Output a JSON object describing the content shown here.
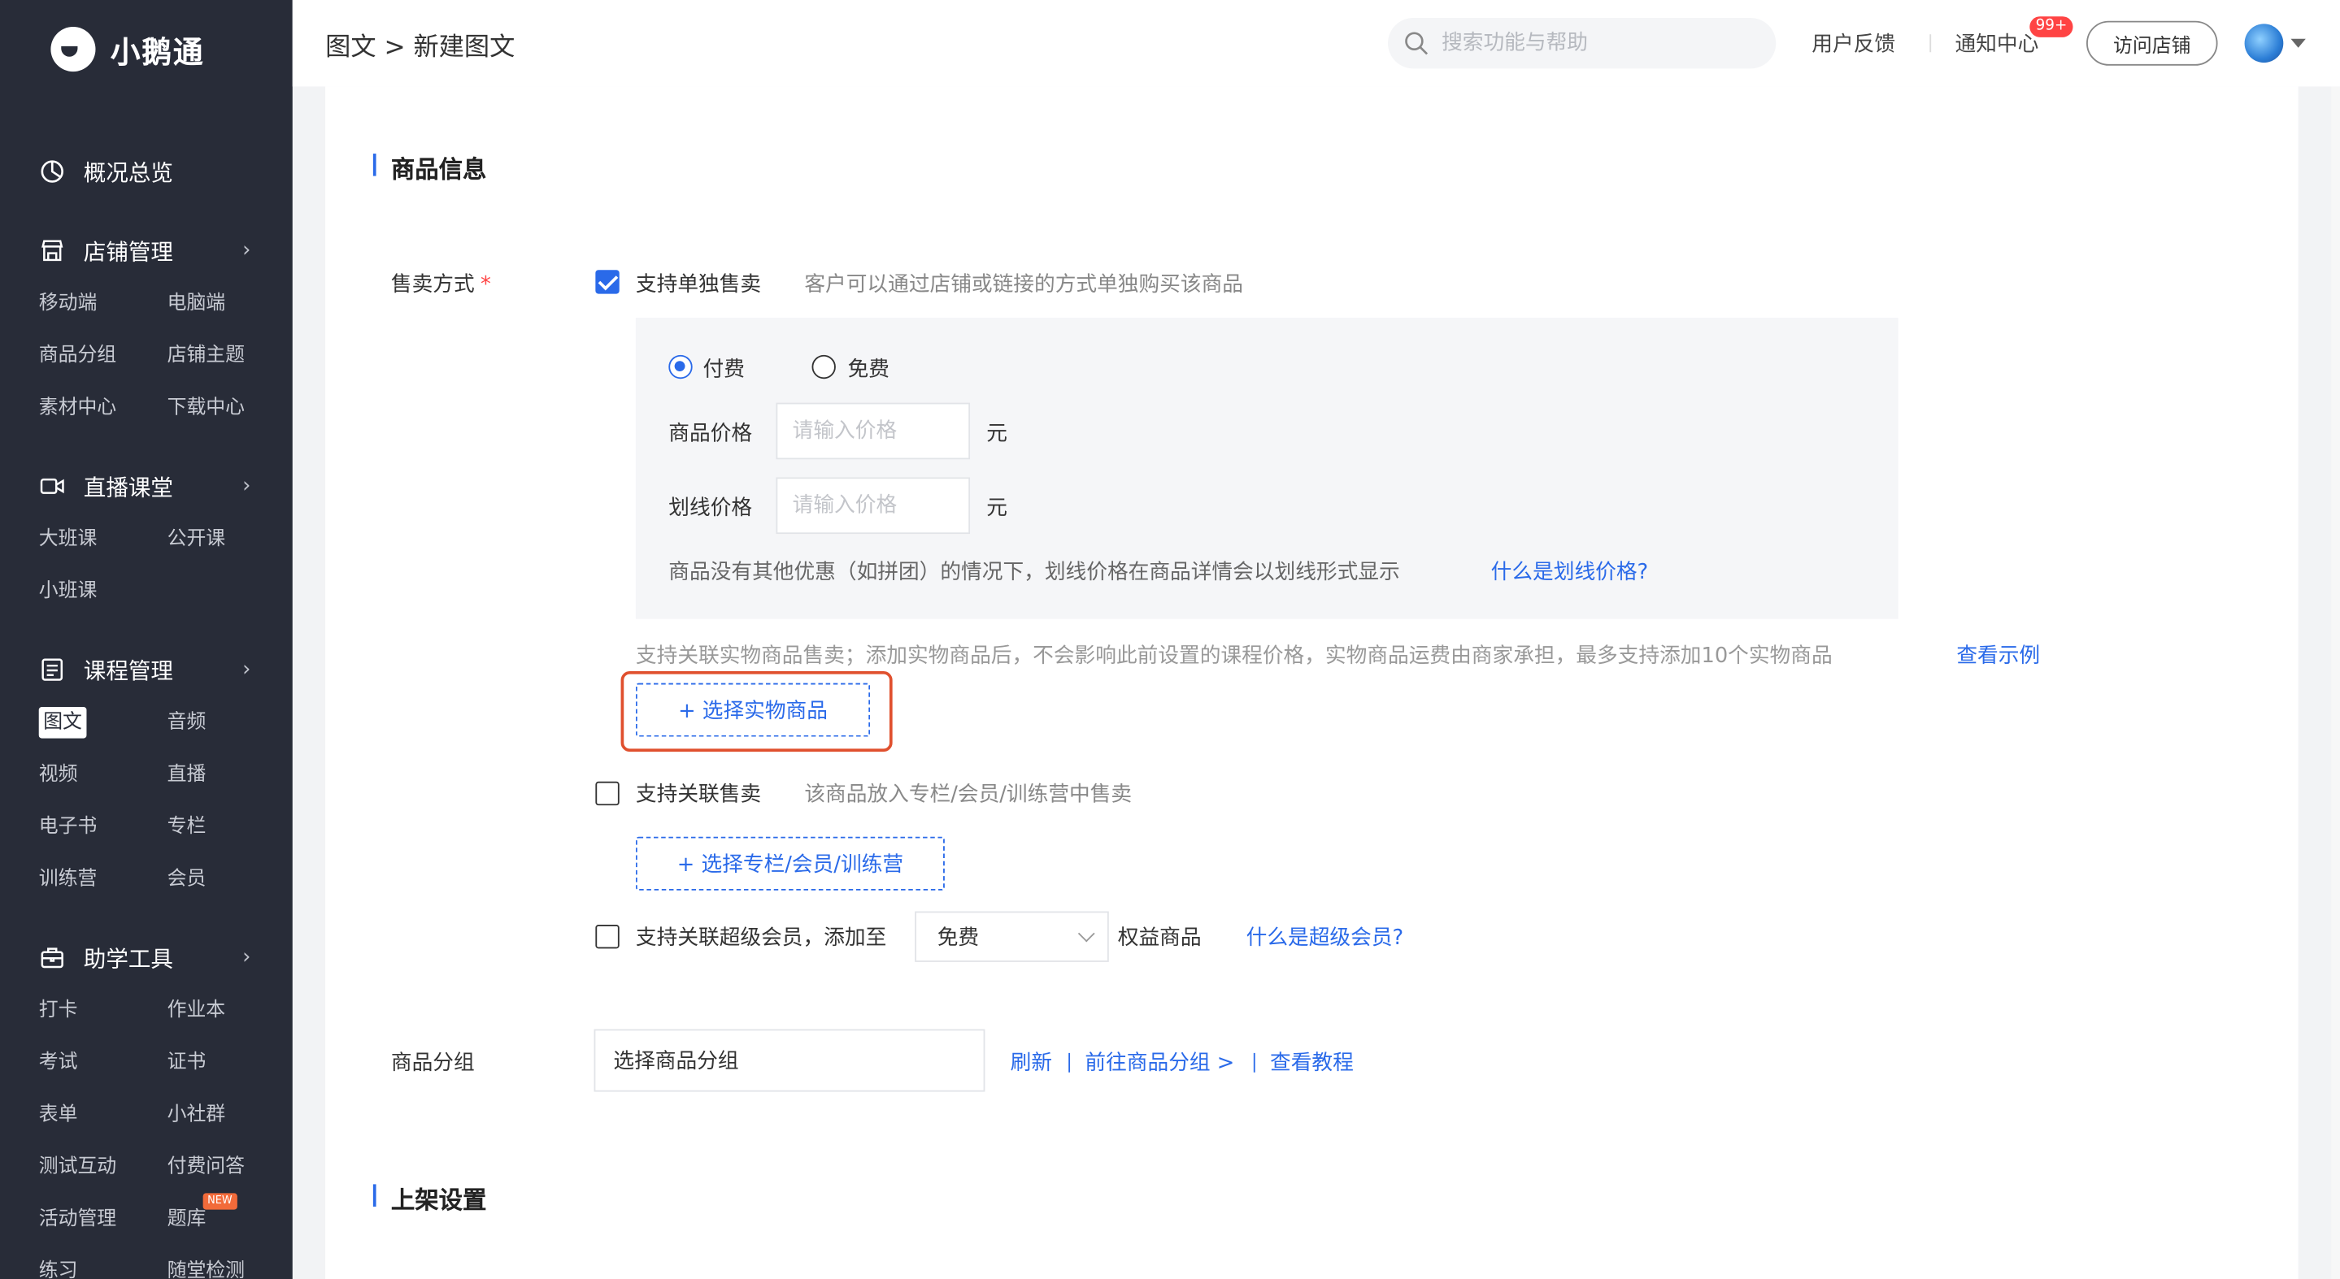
{
  "app": {
    "name": "小鹅通"
  },
  "sidebar": {
    "groups": [
      {
        "label": "概况总览",
        "icon": "dashboard-icon",
        "items": []
      },
      {
        "label": "店铺管理",
        "icon": "store-icon",
        "items": [
          "移动端",
          "电脑端",
          "商品分组",
          "店铺主题",
          "素材中心",
          "下载中心"
        ]
      },
      {
        "label": "直播课堂",
        "icon": "video-camera-icon",
        "items": [
          "大班课",
          "公开课",
          "小班课"
        ]
      },
      {
        "label": "课程管理",
        "icon": "document-icon",
        "items": [
          "图文",
          "音频",
          "视频",
          "直播",
          "电子书",
          "专栏",
          "训练营",
          "会员"
        ]
      },
      {
        "label": "助学工具",
        "icon": "toolbox-icon",
        "items": [
          "打卡",
          "作业本",
          "考试",
          "证书",
          "表单",
          "小社群",
          "测试互动",
          "付费问答",
          "活动管理",
          "题库",
          "练习",
          "随堂检测"
        ]
      }
    ],
    "active_item": "图文",
    "new_tag": "NEW"
  },
  "header": {
    "breadcrumb": "图文 > 新建图文",
    "search_placeholder": "搜索功能与帮助",
    "feedback": "用户反馈",
    "notifications": "通知中心",
    "notification_badge": "99+",
    "visit_store": "访问店铺"
  },
  "form": {
    "section_goods": "商品信息",
    "sell_mode_label": "售卖方式",
    "required_mark": "*",
    "single_sale": {
      "label": "支持单独售卖",
      "hint": "客户可以通过店铺或链接的方式单独购买该商品",
      "checked": true
    },
    "pay_options": {
      "paid": "付费",
      "free": "免费",
      "selected": "付费"
    },
    "price": {
      "label": "商品价格",
      "placeholder": "请输入价格",
      "unit": "元"
    },
    "strike_price": {
      "label": "划线价格",
      "placeholder": "请输入价格",
      "unit": "元"
    },
    "strike_hint": "商品没有其他优惠（如拼团）的情况下，划线价格在商品详情会以划线形式显示",
    "strike_link": "什么是划线价格?",
    "physical_hint": "支持关联实物商品售卖；添加实物商品后，不会影响此前设置的课程价格，实物商品运费由商家承担，最多支持添加10个实物商品",
    "physical_link": "查看示例",
    "choose_physical": "+ 选择实物商品",
    "related_sale": {
      "label": "支持关联售卖",
      "hint": "该商品放入专栏/会员/训练营中售卖",
      "checked": false
    },
    "choose_column": "+ 选择专栏/会员/训练营",
    "super_member": {
      "label": "支持关联超级会员，添加至",
      "select_value": "免费",
      "suffix": "权益商品",
      "link": "什么是超级会员?",
      "checked": false
    },
    "group_label": "商品分组",
    "group_input": "选择商品分组",
    "refresh": "刷新",
    "goto_group": "前往商品分组 >",
    "tutorial": "查看教程",
    "section_publish": "上架设置"
  },
  "colors": {
    "accent": "#2a6ae9",
    "sidebar_bg": "#282c38",
    "highlight": "#e0502e"
  }
}
